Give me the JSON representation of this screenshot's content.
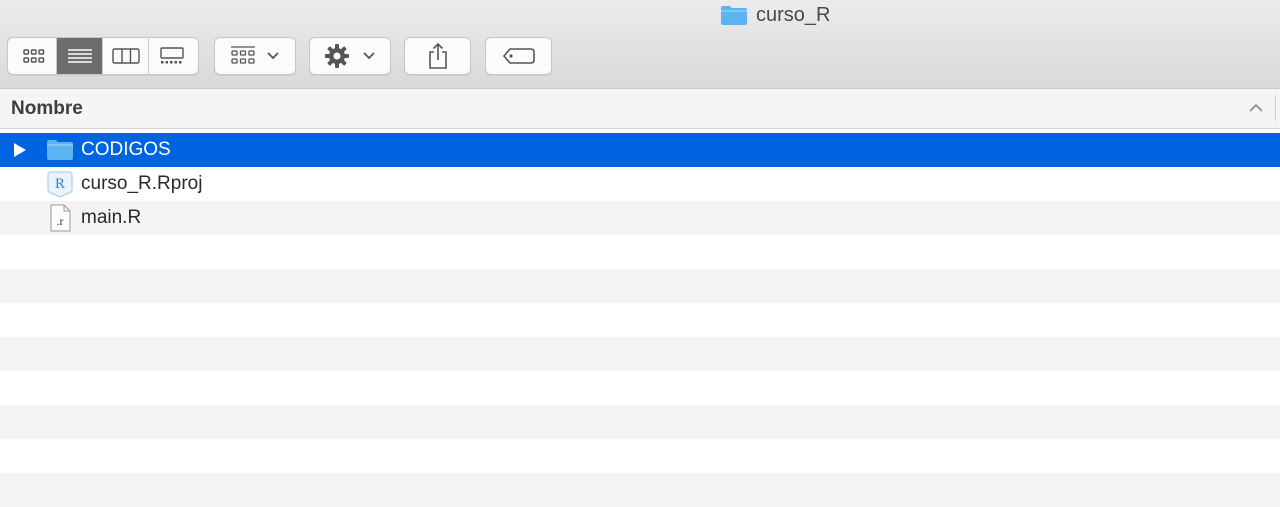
{
  "window": {
    "title": "curso_R"
  },
  "toolbar": {
    "view_modes": [
      "icon-view",
      "list-view",
      "column-view",
      "gallery-view"
    ],
    "active_view": "list-view"
  },
  "columns": {
    "name_header": "Nombre"
  },
  "files": [
    {
      "name": "CODIGOS",
      "icon": "folder-icon",
      "selected": true
    },
    {
      "name": "curso_R.Rproj",
      "icon": "rproj-file-icon",
      "selected": false
    },
    {
      "name": "main.R",
      "icon": "r-script-file-icon",
      "selected": false
    }
  ],
  "colors": {
    "selection": "#0064e1",
    "folder": "#5ab4f0"
  }
}
